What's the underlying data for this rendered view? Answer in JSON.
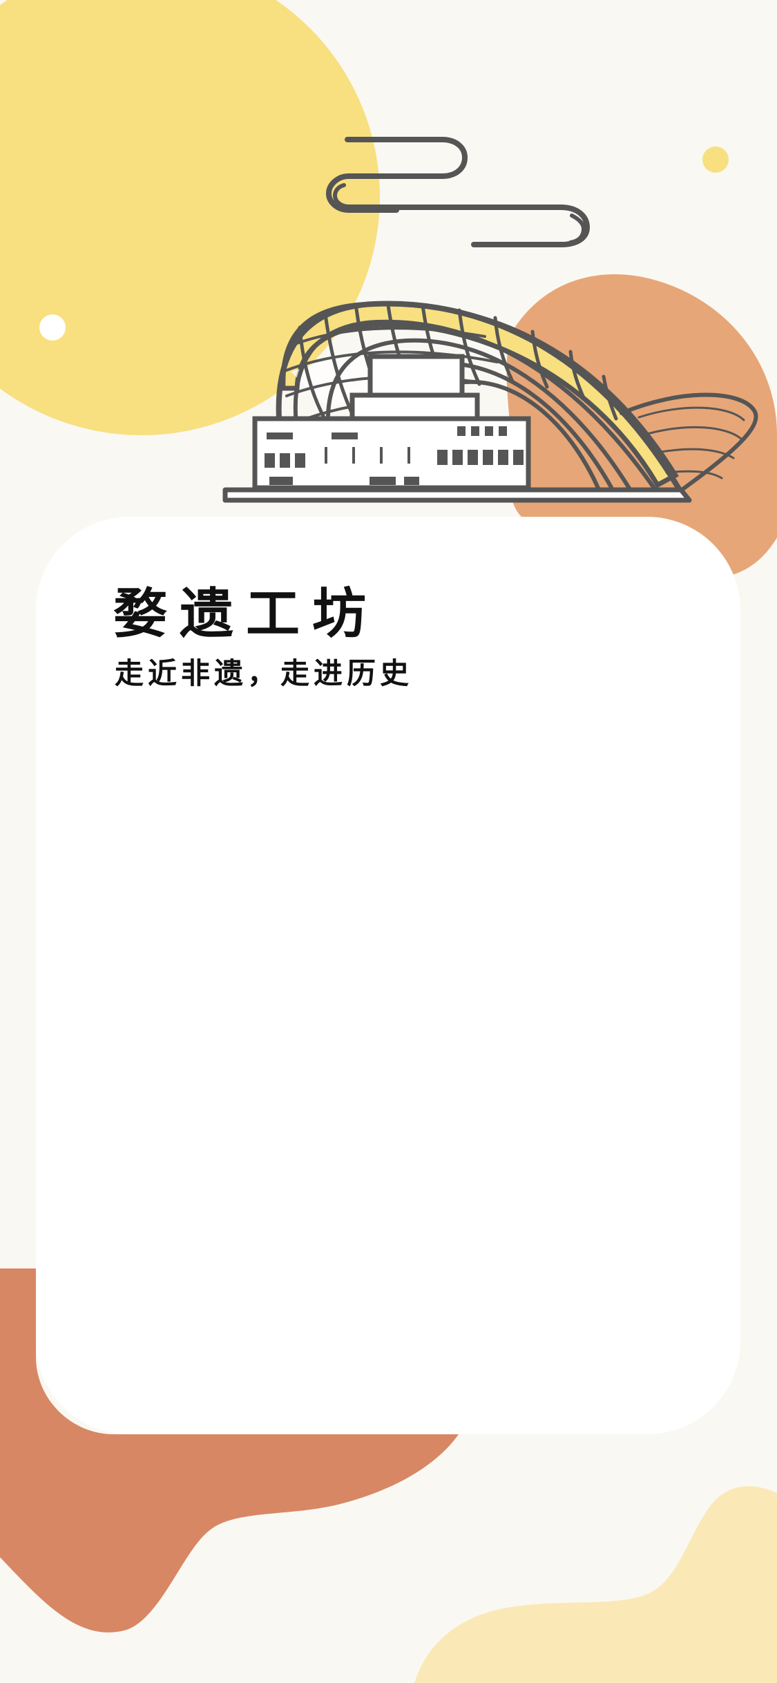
{
  "app": {
    "title": "婺遗工坊",
    "subtitle": "走近非遗，走进历史"
  },
  "colors": {
    "background": "#faf8f3",
    "sun_yellow": "#f8df80",
    "accent_orange": "#e7a677",
    "terracotta": "#d88765",
    "cream_yellow": "#fae9b7",
    "line_dark": "#555555",
    "card": "#ffffff",
    "text": "#111111"
  },
  "icons": {
    "cloud": "cloud-icon",
    "building": "theater-building-icon"
  }
}
